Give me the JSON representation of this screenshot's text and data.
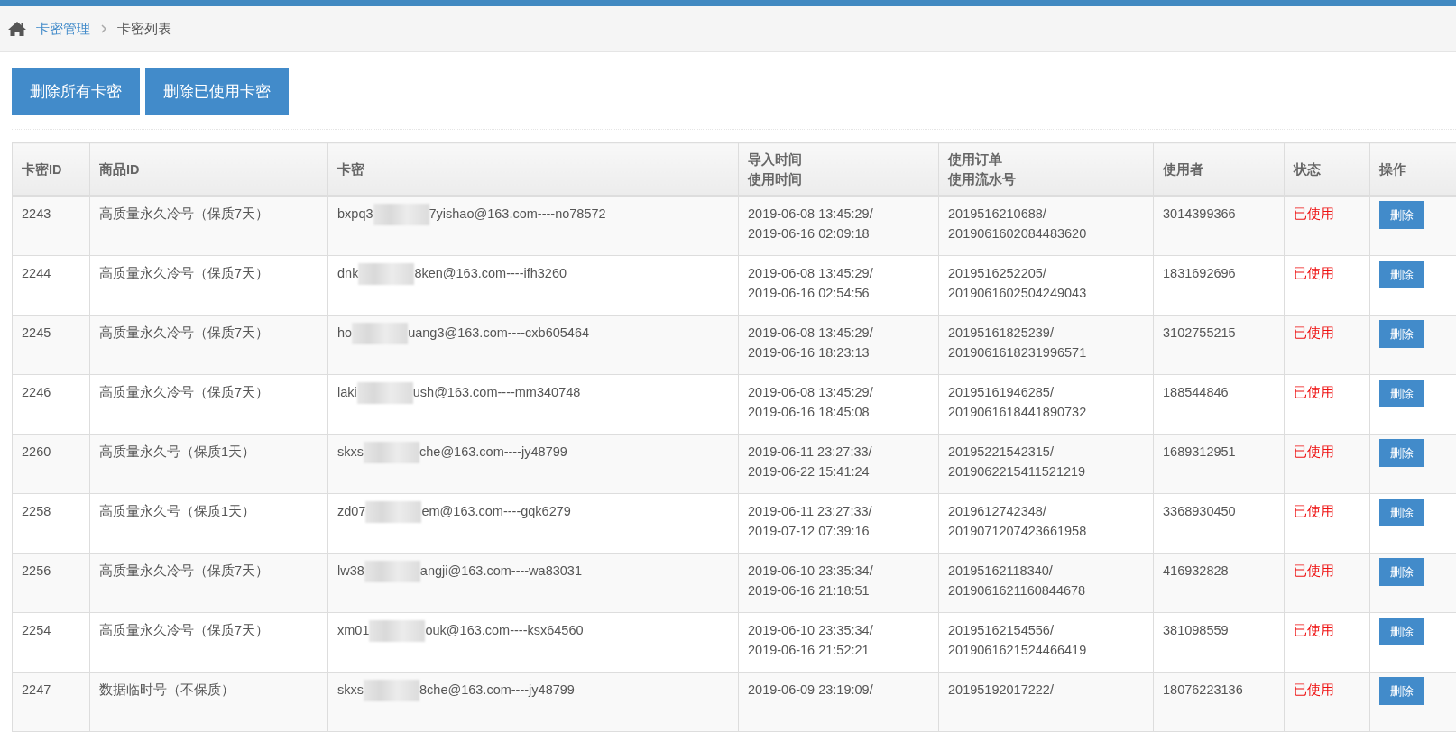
{
  "breadcrumb": {
    "items": [
      "卡密管理",
      "卡密列表"
    ]
  },
  "actions": [
    "删除所有卡密",
    "删除已使用卡密"
  ],
  "table": {
    "columns": [
      {
        "lines": [
          "卡密ID"
        ]
      },
      {
        "lines": [
          "商品ID"
        ]
      },
      {
        "lines": [
          "卡密"
        ]
      },
      {
        "lines": [
          "导入时间",
          "使用时间"
        ]
      },
      {
        "lines": [
          "使用订单",
          "使用流水号"
        ]
      },
      {
        "lines": [
          "使用者"
        ]
      },
      {
        "lines": [
          "状态"
        ]
      },
      {
        "lines": [
          "操作"
        ]
      }
    ],
    "rows": [
      {
        "id": "2243",
        "product": "高质量永久冷号（保质7天）",
        "card_start": "bxpq3",
        "card_end": "7yishao@163.com----no78572",
        "times": [
          "2019-06-08 13:45:29/",
          "2019-06-16 02:09:18"
        ],
        "order": [
          "2019516210688/",
          "2019061602084483620"
        ],
        "user": "3014399366",
        "status": "已使用",
        "used": true,
        "action": "删除"
      },
      {
        "id": "2244",
        "product": "高质量永久冷号（保质7天）",
        "card_start": "dnk",
        "card_end": "8ken@163.com----ifh3260",
        "times": [
          "2019-06-08 13:45:29/",
          "2019-06-16 02:54:56"
        ],
        "order": [
          "2019516252205/",
          "2019061602504249043"
        ],
        "user": "1831692696",
        "status": "已使用",
        "used": true,
        "action": "删除"
      },
      {
        "id": "2245",
        "product": "高质量永久冷号（保质7天）",
        "card_start": "ho",
        "card_end": "uang3@163.com----cxb605464",
        "times": [
          "2019-06-08 13:45:29/",
          "2019-06-16 18:23:13"
        ],
        "order": [
          "20195161825239/",
          "2019061618231996571"
        ],
        "user": "3102755215",
        "status": "已使用",
        "used": true,
        "action": "删除"
      },
      {
        "id": "2246",
        "product": "高质量永久冷号（保质7天）",
        "card_start": "laki",
        "card_end": "ush@163.com----mm340748",
        "times": [
          "2019-06-08 13:45:29/",
          "2019-06-16 18:45:08"
        ],
        "order": [
          "20195161946285/",
          "2019061618441890732"
        ],
        "user": "188544846",
        "status": "已使用",
        "used": true,
        "action": "删除"
      },
      {
        "id": "2260",
        "product": "高质量永久号（保质1天）",
        "card_start": "skxs",
        "card_end": "che@163.com----jy48799",
        "times": [
          "2019-06-11 23:27:33/",
          "2019-06-22 15:41:24"
        ],
        "order": [
          "20195221542315/",
          "2019062215411521219"
        ],
        "user": "1689312951",
        "status": "已使用",
        "used": true,
        "action": "删除"
      },
      {
        "id": "2258",
        "product": "高质量永久号（保质1天）",
        "card_start": "zd07",
        "card_end": "em@163.com----gqk6279",
        "times": [
          "2019-06-11 23:27:33/",
          "2019-07-12 07:39:16"
        ],
        "order": [
          "2019612742348/",
          "2019071207423661958"
        ],
        "user": "3368930450",
        "status": "已使用",
        "used": true,
        "action": "删除"
      },
      {
        "id": "2256",
        "product": "高质量永久冷号（保质7天）",
        "card_start": "lw38",
        "card_end": "angji@163.com----wa83031",
        "times": [
          "2019-06-10 23:35:34/",
          "2019-06-16 21:18:51"
        ],
        "order": [
          "20195162118340/",
          "2019061621160844678"
        ],
        "user": "416932828",
        "status": "已使用",
        "used": true,
        "action": "删除"
      },
      {
        "id": "2254",
        "product": "高质量永久冷号（保质7天）",
        "card_start": "xm01",
        "card_end": "ouk@163.com----ksx64560",
        "times": [
          "2019-06-10 23:35:34/",
          "2019-06-16 21:52:21"
        ],
        "order": [
          "20195162154556/",
          "2019061621524466419"
        ],
        "user": "381098559",
        "status": "已使用",
        "used": true,
        "action": "删除"
      },
      {
        "id": "2247",
        "product": "数据临时号（不保质）",
        "card_start": "skxs",
        "card_end": "8che@163.com----jy48799",
        "times": [
          "2019-06-09 23:19:09/"
        ],
        "order": [
          "20195192017222/"
        ],
        "user": "18076223136",
        "status": "已使用",
        "used": true,
        "action": "删除"
      }
    ]
  }
}
